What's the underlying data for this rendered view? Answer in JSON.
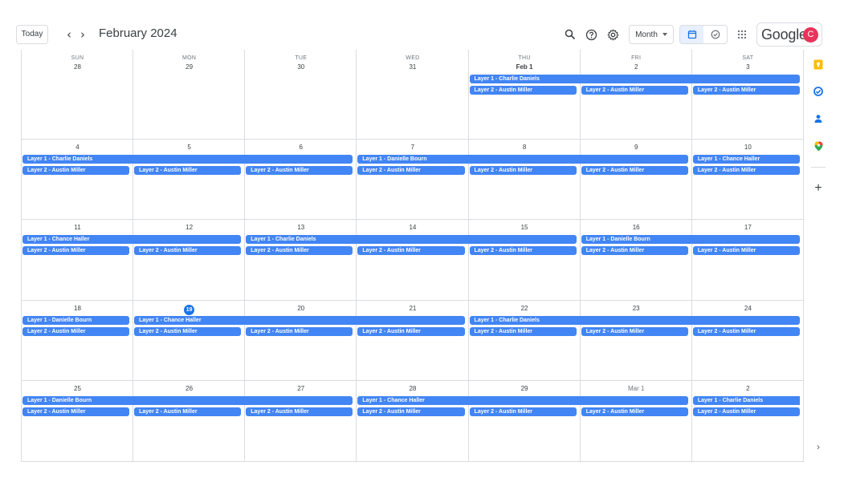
{
  "header": {
    "today_label": "Today",
    "prev_glyph": "‹",
    "next_glyph": "›",
    "title": "February 2024",
    "view_label": "Month",
    "brand": "Google",
    "avatar_initial": "C",
    "avatar_color": "#e8335a"
  },
  "icons": {
    "search": "search-icon",
    "help": "help-icon",
    "settings": "settings-icon",
    "calendar": "calendar-icon",
    "tasks": "tasks-icon",
    "apps": "apps-grid-icon"
  },
  "colors": {
    "event": "#4285f4",
    "today": "#1a73e8",
    "grid_line": "#dadce0"
  },
  "weekdays": [
    "SUN",
    "MON",
    "TUE",
    "WED",
    "THU",
    "FRI",
    "SAT"
  ],
  "weeks": [
    {
      "days": [
        {
          "label": "28",
          "muted": false
        },
        {
          "label": "29",
          "muted": false
        },
        {
          "label": "30",
          "muted": false
        },
        {
          "label": "31",
          "muted": false
        },
        {
          "label": "Feb 1",
          "muted": false,
          "bold": true
        },
        {
          "label": "2",
          "muted": false
        },
        {
          "label": "3",
          "muted": false
        }
      ],
      "events": [
        {
          "title": "Layer 1 - Charlie Daniels",
          "start": 4,
          "span": 3,
          "row": 0
        },
        {
          "title": "Layer 2 - Austin Miller",
          "start": 4,
          "span": 1,
          "row": 1
        },
        {
          "title": "Layer 2 - Austin Miller",
          "start": 5,
          "span": 1,
          "row": 1
        },
        {
          "title": "Layer 2 - Austin Miller",
          "start": 6,
          "span": 1,
          "row": 1
        }
      ]
    },
    {
      "days": [
        {
          "label": "4"
        },
        {
          "label": "5"
        },
        {
          "label": "6"
        },
        {
          "label": "7"
        },
        {
          "label": "8"
        },
        {
          "label": "9"
        },
        {
          "label": "10"
        }
      ],
      "events": [
        {
          "title": "Layer 1 - Charlie Daniels",
          "start": 0,
          "span": 3,
          "row": 0
        },
        {
          "title": "Layer 1 - Danielle Bourn",
          "start": 3,
          "span": 3,
          "row": 0
        },
        {
          "title": "Layer 1 - Chance Haller",
          "start": 6,
          "span": 1,
          "row": 0
        },
        {
          "title": "Layer 2 - Austin Miller",
          "start": 0,
          "span": 1,
          "row": 1
        },
        {
          "title": "Layer 2 - Austin Miller",
          "start": 1,
          "span": 1,
          "row": 1
        },
        {
          "title": "Layer 2 - Austin Miller",
          "start": 2,
          "span": 1,
          "row": 1
        },
        {
          "title": "Layer 2 - Austin Miller",
          "start": 3,
          "span": 1,
          "row": 1
        },
        {
          "title": "Layer 2 - Austin Miller",
          "start": 4,
          "span": 1,
          "row": 1
        },
        {
          "title": "Layer 2 - Austin Miller",
          "start": 5,
          "span": 1,
          "row": 1
        },
        {
          "title": "Layer 2 - Austin Miller",
          "start": 6,
          "span": 1,
          "row": 1
        }
      ]
    },
    {
      "days": [
        {
          "label": "11"
        },
        {
          "label": "12"
        },
        {
          "label": "13"
        },
        {
          "label": "14"
        },
        {
          "label": "15"
        },
        {
          "label": "16"
        },
        {
          "label": "17"
        }
      ],
      "events": [
        {
          "title": "Layer 1 - Chance Haller",
          "start": 0,
          "span": 2,
          "row": 0
        },
        {
          "title": "Layer 1 - Charlie Daniels",
          "start": 2,
          "span": 3,
          "row": 0
        },
        {
          "title": "Layer 1 - Danielle Bourn",
          "start": 5,
          "span": 2,
          "row": 0
        },
        {
          "title": "Layer 2 - Austin Miller",
          "start": 0,
          "span": 1,
          "row": 1
        },
        {
          "title": "Layer 2 - Austin Miller",
          "start": 1,
          "span": 1,
          "row": 1
        },
        {
          "title": "Layer 2 - Austin Miller",
          "start": 2,
          "span": 1,
          "row": 1
        },
        {
          "title": "Layer 2 - Austin Miller",
          "start": 3,
          "span": 1,
          "row": 1
        },
        {
          "title": "Layer 2 - Austin Miller",
          "start": 4,
          "span": 1,
          "row": 1
        },
        {
          "title": "Layer 2 - Austin Miller",
          "start": 5,
          "span": 1,
          "row": 1
        },
        {
          "title": "Layer 2 - Austin Miller",
          "start": 6,
          "span": 1,
          "row": 1
        }
      ]
    },
    {
      "days": [
        {
          "label": "18"
        },
        {
          "label": "19",
          "today": true
        },
        {
          "label": "20"
        },
        {
          "label": "21"
        },
        {
          "label": "22"
        },
        {
          "label": "23"
        },
        {
          "label": "24"
        }
      ],
      "events": [
        {
          "title": "Layer 1 - Danielle Bourn",
          "start": 0,
          "span": 1,
          "row": 0
        },
        {
          "title": "Layer 1 - Chance Haller",
          "start": 1,
          "span": 3,
          "row": 0
        },
        {
          "title": "Layer 1 - Charlie Daniels",
          "start": 4,
          "span": 3,
          "row": 0
        },
        {
          "title": "Layer 2 - Austin Miller",
          "start": 0,
          "span": 1,
          "row": 1
        },
        {
          "title": "Layer 2 - Austin Miller",
          "start": 1,
          "span": 1,
          "row": 1
        },
        {
          "title": "Layer 2 - Austin Miller",
          "start": 2,
          "span": 1,
          "row": 1
        },
        {
          "title": "Layer 2 - Austin Miller",
          "start": 3,
          "span": 1,
          "row": 1
        },
        {
          "title": "Layer 2 - Austin Miller",
          "start": 4,
          "span": 1,
          "row": 1
        },
        {
          "title": "Layer 2 - Austin Miller",
          "start": 5,
          "span": 1,
          "row": 1
        },
        {
          "title": "Layer 2 - Austin Miller",
          "start": 6,
          "span": 1,
          "row": 1
        }
      ]
    },
    {
      "days": [
        {
          "label": "25"
        },
        {
          "label": "26"
        },
        {
          "label": "27"
        },
        {
          "label": "28"
        },
        {
          "label": "29"
        },
        {
          "label": "Mar 1",
          "muted": true
        },
        {
          "label": "2"
        }
      ],
      "events": [
        {
          "title": "Layer 1 - Danielle Bourn",
          "start": 0,
          "span": 3,
          "row": 0
        },
        {
          "title": "Layer 1 - Chance Haller",
          "start": 3,
          "span": 3,
          "row": 0
        },
        {
          "title": "Layer 1 - Charlie Daniels",
          "start": 6,
          "span": 1,
          "row": 0,
          "continues": true
        },
        {
          "title": "Layer 2 - Austin Miller",
          "start": 0,
          "span": 1,
          "row": 1
        },
        {
          "title": "Layer 2 - Austin Miller",
          "start": 1,
          "span": 1,
          "row": 1
        },
        {
          "title": "Layer 2 - Austin Miller",
          "start": 2,
          "span": 1,
          "row": 1
        },
        {
          "title": "Layer 2 - Austin Miller",
          "start": 3,
          "span": 1,
          "row": 1
        },
        {
          "title": "Layer 2 - Austin Miller",
          "start": 4,
          "span": 1,
          "row": 1
        },
        {
          "title": "Layer 2 - Austin Miller",
          "start": 5,
          "span": 1,
          "row": 1
        },
        {
          "title": "Layer 2 - Austin Miller",
          "start": 6,
          "span": 1,
          "row": 1
        }
      ]
    }
  ],
  "side_panel": {
    "items": [
      {
        "name": "keep-icon",
        "color": "#fbbc04"
      },
      {
        "name": "tasks-side-icon",
        "color": "#1a73e8"
      },
      {
        "name": "contacts-icon",
        "color": "#1a73e8"
      },
      {
        "name": "maps-icon",
        "color": "#34a853"
      }
    ],
    "add_glyph": "+",
    "expand_glyph": "›"
  }
}
